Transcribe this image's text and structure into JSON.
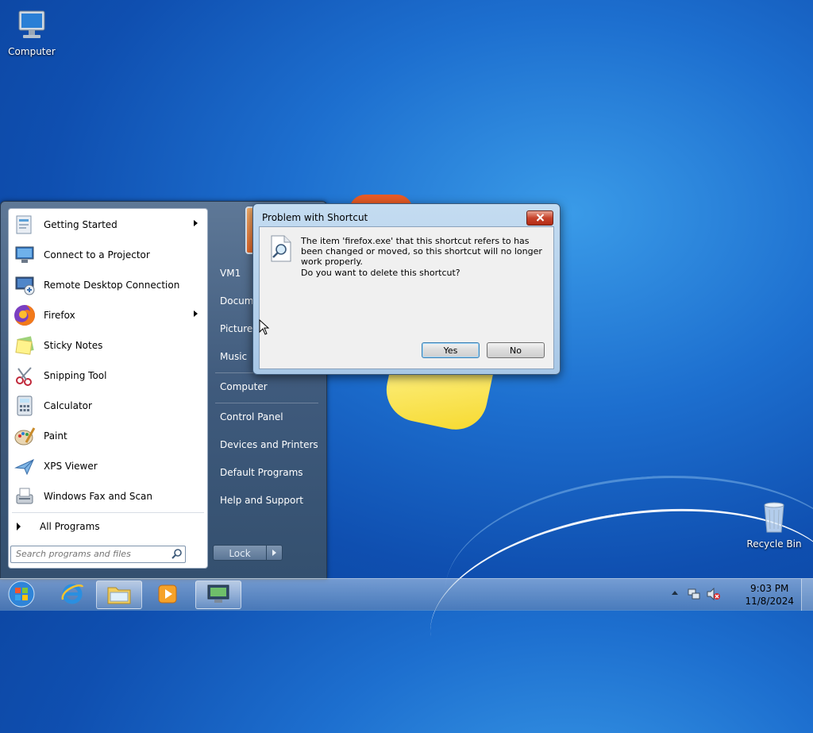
{
  "desktop": {
    "icons": [
      {
        "label": "Computer"
      },
      {
        "label": "Recycle Bin"
      }
    ]
  },
  "start_menu": {
    "programs": [
      {
        "label": "Getting Started",
        "icon": "getting-started-icon",
        "submenu": true
      },
      {
        "label": "Connect to a Projector",
        "icon": "projector-icon",
        "submenu": false
      },
      {
        "label": "Remote Desktop Connection",
        "icon": "remote-desktop-icon",
        "submenu": false
      },
      {
        "label": "Firefox",
        "icon": "firefox-icon",
        "submenu": true
      },
      {
        "label": "Sticky Notes",
        "icon": "sticky-notes-icon",
        "submenu": false
      },
      {
        "label": "Snipping Tool",
        "icon": "snipping-tool-icon",
        "submenu": false
      },
      {
        "label": "Calculator",
        "icon": "calculator-icon",
        "submenu": false
      },
      {
        "label": "Paint",
        "icon": "paint-icon",
        "submenu": false
      },
      {
        "label": "XPS Viewer",
        "icon": "xps-viewer-icon",
        "submenu": false
      },
      {
        "label": "Windows Fax and Scan",
        "icon": "fax-scan-icon",
        "submenu": false
      }
    ],
    "all_programs": "All Programs",
    "search_placeholder": "Search programs and files",
    "right_items": [
      "VM1",
      "Docume",
      "Pictures",
      "Music",
      "Computer",
      "Control Panel",
      "Devices and Printers",
      "Default Programs",
      "Help and Support"
    ],
    "lock_label": "Lock"
  },
  "dialog": {
    "title": "Problem with Shortcut",
    "message": "The item 'firefox.exe' that this shortcut refers to has been changed or moved, so this shortcut will no longer work properly.",
    "question": "Do you want to delete this shortcut?",
    "yes_label": "Yes",
    "no_label": "No"
  },
  "taskbar": {
    "time": "9:03 PM",
    "date": "11/8/2024"
  }
}
